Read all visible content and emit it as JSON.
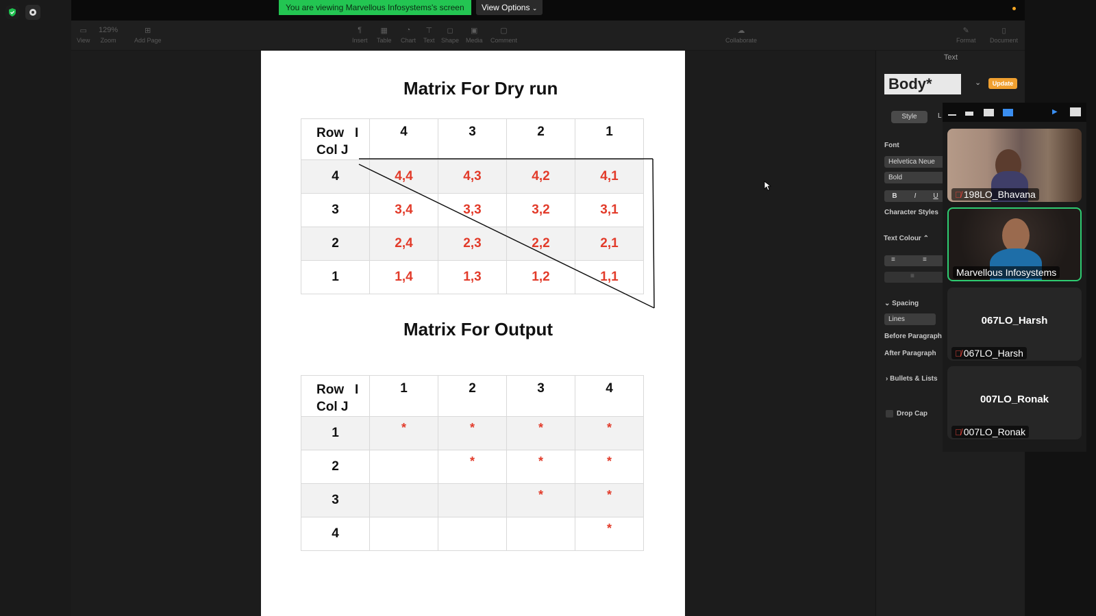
{
  "zoom": {
    "share_banner": "You are viewing Marvellous Infosystems's screen",
    "view_options": "View Options"
  },
  "pages_toolbar": {
    "view": "View",
    "zoom_value": "129%",
    "zoom": "Zoom",
    "add_page": "Add Page",
    "insert": "Insert",
    "table": "Table",
    "chart": "Chart",
    "text": "Text",
    "shape": "Shape",
    "media": "Media",
    "comment": "Comment",
    "collaborate": "Collaborate",
    "format": "Format",
    "document": "Document"
  },
  "document": {
    "title1": "Matrix For Dry run",
    "table1": {
      "header_row_label": "Row   I",
      "header_col_label": "Col J",
      "columns": [
        "4",
        "3",
        "2",
        "1"
      ],
      "rows": [
        {
          "label": "4",
          "cells": [
            "4,4",
            "4,3",
            "4,2",
            "4,1"
          ]
        },
        {
          "label": "3",
          "cells": [
            "3,4",
            "3,3",
            "3,2",
            "3,1"
          ]
        },
        {
          "label": "2",
          "cells": [
            "2,4",
            "2,3",
            "2,2",
            "2,1"
          ]
        },
        {
          "label": "1",
          "cells": [
            "1,4",
            "1,3",
            "1,2",
            "1,1"
          ]
        }
      ]
    },
    "title2": "Matrix For Output",
    "table2": {
      "header_row_label": "Row   I",
      "header_col_label": "Col J",
      "columns": [
        "1",
        "2",
        "3",
        "4"
      ],
      "rows": [
        {
          "label": "1",
          "cells": [
            "*",
            "*",
            "*",
            "*"
          ]
        },
        {
          "label": "2",
          "cells": [
            "",
            "*",
            "*",
            "*"
          ]
        },
        {
          "label": "3",
          "cells": [
            "",
            "",
            "*",
            "*"
          ]
        },
        {
          "label": "4",
          "cells": [
            "",
            "",
            "",
            "*"
          ]
        }
      ]
    }
  },
  "inspector": {
    "title": "Text",
    "paragraph_style": "Body*",
    "update": "Update",
    "tab_style": "Style",
    "tab_layout": "L",
    "font_label": "Font",
    "font_name": "Helvetica Neue",
    "font_weight": "Bold",
    "bold": "B",
    "italic": "I",
    "underline": "U",
    "character_styles": "Character Styles",
    "text_colour": "Text Colour ⌃",
    "spacing": "Spacing",
    "lines": "Lines",
    "before_paragraph": "Before Paragraph",
    "after_paragraph": "After Paragraph",
    "bullets_lists": "Bullets & Lists",
    "drop_cap": "Drop Cap"
  },
  "participants": [
    {
      "name": "198LO_Bhavana",
      "muted": true,
      "video": true
    },
    {
      "name": "Marvellous Infosystems",
      "muted": false,
      "video": true,
      "active_speaker": true
    },
    {
      "name": "067LO_Harsh",
      "muted": true,
      "video": false
    },
    {
      "name": "007LO_Ronak",
      "muted": true,
      "video": false
    }
  ],
  "colors": {
    "banner_green": "#23c552",
    "matrix_red": "#e23b2a",
    "update_orange": "#f0a030",
    "active_speaker_border": "#2ecc71"
  }
}
